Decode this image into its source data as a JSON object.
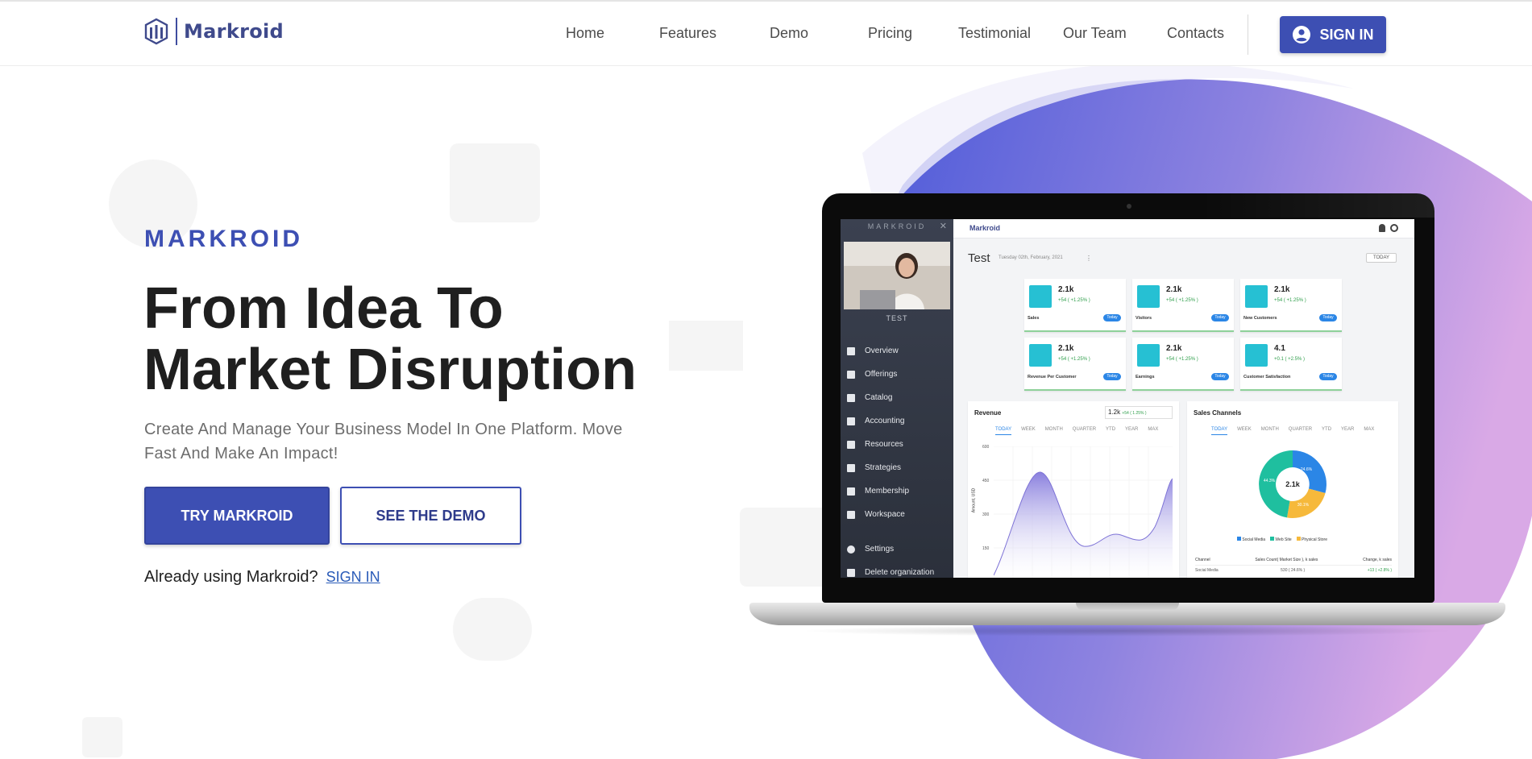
{
  "brand": {
    "name": "Markroid"
  },
  "nav": {
    "items": [
      {
        "label": "Home"
      },
      {
        "label": "Features"
      },
      {
        "label": "Demo"
      },
      {
        "label": "Pricing"
      },
      {
        "label": "Testimonial"
      },
      {
        "label": "Our Team"
      },
      {
        "label": "Contacts"
      }
    ],
    "signin_label": "SIGN IN"
  },
  "hero": {
    "eyebrow": "MARKROID",
    "headline_line1": "From Idea To",
    "headline_line2": "Market Disruption",
    "subtext": "Create And Manage Your Business Model In One Platform. Move Fast And Make An Impact!",
    "primary_cta": "TRY MARKROID",
    "secondary_cta": "SEE THE DEMO",
    "already_text": "Already using Markroid?",
    "already_link": "SIGN IN"
  },
  "mockup": {
    "sidebar_title": "MARKROID",
    "user_name": "TEST",
    "menu": [
      "Overview",
      "Offerings",
      "Catalog",
      "Accounting",
      "Resources",
      "Strategies",
      "Membership",
      "Workspace",
      "Settings",
      "Delete organization"
    ],
    "app_logo": "Markroid",
    "page_title": "Test",
    "page_date": "Tuesday 02th, February, 2021",
    "today_button": "TODAY",
    "kpis": [
      {
        "value": "2.1k",
        "delta": "+54 ( +1.25% )",
        "label": "Sales",
        "badge": "Today"
      },
      {
        "value": "2.1k",
        "delta": "+54 ( +1.25% )",
        "label": "Visitors",
        "badge": "Today"
      },
      {
        "value": "2.1k",
        "delta": "+54 ( +1.25% )",
        "label": "New Customers",
        "badge": "Today"
      },
      {
        "value": "2.1k",
        "delta": "+54 ( +1.25% )",
        "label": "Revenue Per Customer",
        "badge": "Today"
      },
      {
        "value": "2.1k",
        "delta": "+54 ( +1.25% )",
        "label": "Earnings",
        "badge": "Today"
      },
      {
        "value": "4.1",
        "delta": "+0.1 ( +2.5% )",
        "label": "Customer Satisfaction",
        "badge": "Today"
      }
    ],
    "revenue": {
      "title": "Revenue",
      "value": "1.2k",
      "delta": "+54 ( 1.25% )",
      "tabs": [
        "TODAY",
        "WEEK",
        "MONTH",
        "QUARTER",
        "YTD",
        "YEAR",
        "MAX"
      ],
      "ylabel": "Amount, USD",
      "yticks": [
        "600",
        "450",
        "300",
        "150"
      ]
    },
    "channels": {
      "title": "Sales Channels",
      "tabs": [
        "TODAY",
        "WEEK",
        "MONTH",
        "QUARTER",
        "YTD",
        "YEAR",
        "MAX"
      ],
      "center": "2.1k",
      "slices": [
        {
          "name": "Social Media",
          "pct": "24.6%",
          "color": "#2b86e6"
        },
        {
          "name": "Physical Store",
          "pct": "30.1%",
          "color": "#f6b93b"
        },
        {
          "name": "Web Site",
          "pct": "44.3%",
          "color": "#1fbf9f"
        }
      ],
      "table_headers": [
        "Channel",
        "Sales Count( Market Size ), k sales",
        "Change, k sales"
      ],
      "table_row": [
        "Social Media",
        "530 ( 24.6% )",
        "+13 ( +2.8% )"
      ]
    }
  },
  "colors": {
    "primary": "#3d4fb3",
    "heading": "#1f1f1f",
    "muted": "#6d6d6d",
    "link": "#2a5bb8",
    "blob_start": "#4e5bd9",
    "blob_end": "#d8a6e6"
  }
}
